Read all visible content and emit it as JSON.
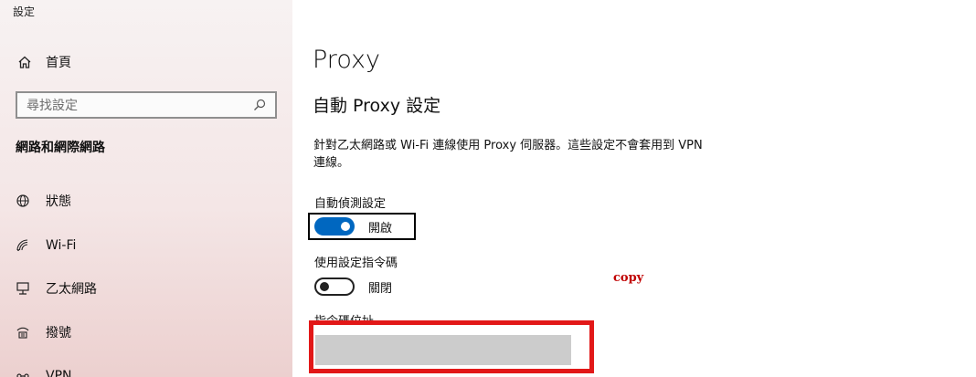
{
  "window": {
    "title": "設定"
  },
  "sidebar": {
    "home_label": "首頁",
    "search_placeholder": "尋找設定",
    "section_header": "網路和網際網路",
    "items": [
      {
        "label": "狀態",
        "icon": "globe-icon"
      },
      {
        "label": "Wi-Fi",
        "icon": "wifi-icon"
      },
      {
        "label": "乙太網路",
        "icon": "ethernet-icon"
      },
      {
        "label": "撥號",
        "icon": "dialup-icon"
      },
      {
        "label": "VPN",
        "icon": "vpn-icon"
      }
    ]
  },
  "main": {
    "title": "Proxy",
    "auto_section_title": "自動 Proxy 設定",
    "description": "針對乙太網路或 Wi-Fi 連線使用 Proxy 伺服器。這些設定不會套用到 VPN 連線。",
    "auto_detect": {
      "label": "自動偵測設定",
      "state": "開啟",
      "on": true
    },
    "use_script": {
      "label": "使用設定指令碼",
      "state": "關閉",
      "on": false
    },
    "script_address": {
      "label": "指令碼位址",
      "value": ""
    }
  },
  "overlay": {
    "copy_text": "copy",
    "highlight_color": "#e21818"
  },
  "colors": {
    "accent": "#0067c0",
    "sidebar_bg": "#f4e6e6"
  }
}
